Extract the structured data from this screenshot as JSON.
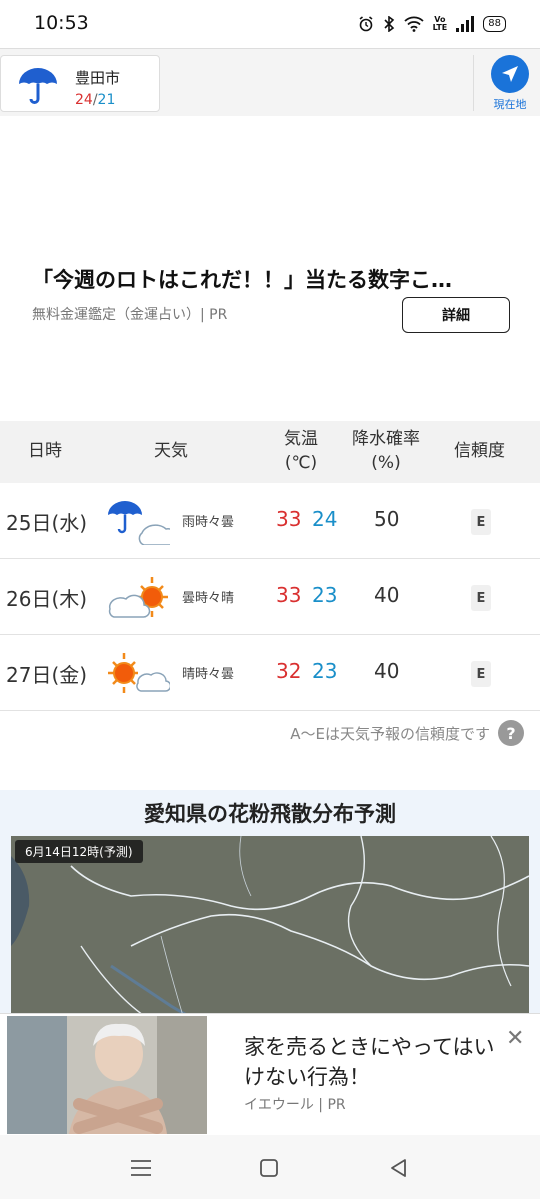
{
  "status_bar": {
    "time": "10:53",
    "battery": "88",
    "volte_top": "Vo",
    "volte_bottom": "LTE"
  },
  "header": {
    "city": "豊田市",
    "temp_high": "24",
    "temp_sep": "/",
    "temp_low": "21",
    "weather_icon": "umbrella-icon",
    "current_location_label": "現在地"
  },
  "ad": {
    "title": "「今週のロトはこれだ！！」当たる数字こ…",
    "sponsor": "無料金運鑑定（金運占い）| PR",
    "detail_button": "詳細"
  },
  "forecast": {
    "headers": {
      "date": "日時",
      "weather": "天気",
      "temp_line1": "気温",
      "temp_line2": "(℃)",
      "pop_line1": "降水確率",
      "pop_line2": "(%)",
      "reliability": "信頼度"
    },
    "rows": [
      {
        "date": "25日(水)",
        "icon": "rain-then-cloud-icon",
        "desc": "雨時々曇",
        "high": "33",
        "low": "24",
        "pop": "50",
        "reliability": "E"
      },
      {
        "date": "26日(木)",
        "icon": "cloud-then-sun-icon",
        "desc": "曇時々晴",
        "high": "33",
        "low": "23",
        "pop": "40",
        "reliability": "E"
      },
      {
        "date": "27日(金)",
        "icon": "sun-then-cloud-icon",
        "desc": "晴時々曇",
        "high": "32",
        "low": "23",
        "pop": "40",
        "reliability": "E"
      }
    ],
    "reliability_note": "A〜Eは天気予報の信頼度です",
    "help_symbol": "?"
  },
  "pollen": {
    "title": "愛知県の花粉飛散分布予測",
    "map_label": "6月14日12時(予測)"
  },
  "bottom_ad": {
    "title": "家を売るときにやってはいけない行為！",
    "source": "イエウール | PR",
    "close_symbol": "✕"
  },
  "colors": {
    "high_temp": "#d93030",
    "low_temp": "#1a8fc9",
    "accent": "#1a73d9"
  }
}
